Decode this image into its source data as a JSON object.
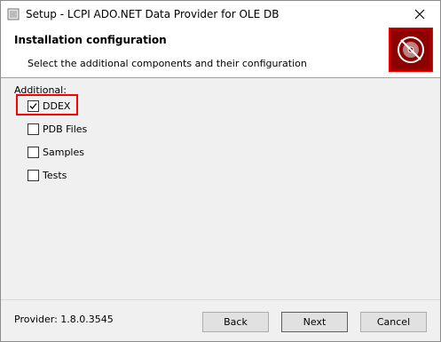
{
  "window": {
    "title": "Setup - LCPI ADO.NET Data Provider for OLE DB"
  },
  "header": {
    "title": "Installation configuration",
    "subtitle": "Select the additional components and their configuration"
  },
  "additional": {
    "label": "Additional:",
    "items": [
      {
        "label": "DDEX",
        "checked": true
      },
      {
        "label": "PDB Files",
        "checked": false
      },
      {
        "label": "Samples",
        "checked": false
      },
      {
        "label": "Tests",
        "checked": false
      }
    ]
  },
  "footer": {
    "provider": "Provider: 1.8.0.3545",
    "back_label": "Back",
    "next_label": "Next",
    "cancel_label": "Cancel"
  },
  "colors": {
    "logo_bg": "#a80000",
    "highlight": "#ff0000"
  },
  "icons": {
    "app": "setup-app-icon",
    "close": "close-icon",
    "logo": "disc-logo-icon"
  }
}
